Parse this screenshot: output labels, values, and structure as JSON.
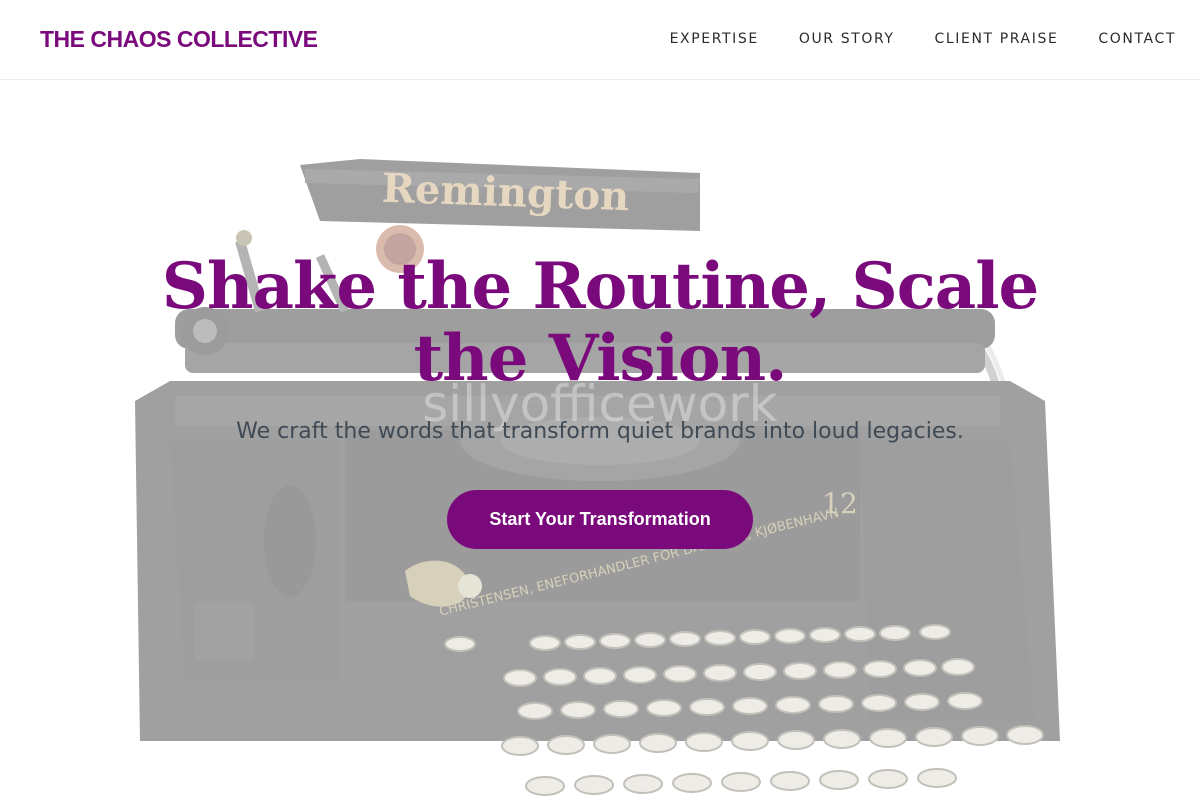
{
  "header": {
    "brand": "THE CHAOS COLLECTIVE",
    "nav": [
      {
        "label": "EXPERTISE"
      },
      {
        "label": "OUR STORY"
      },
      {
        "label": "CLIENT PRAISE"
      },
      {
        "label": "CONTACT"
      }
    ]
  },
  "hero": {
    "headline": "Shake the Routine, Scale the Vision.",
    "subhead": "We craft the words that transform quiet brands into loud legacies.",
    "cta_label": "Start Your Transformation",
    "image": {
      "brand_text": "Remington",
      "watermark": "sillyofficework",
      "model_number": "12",
      "plate_text": "CHRISTENSEN, ENEFORHANDLER FOR DANMARK, KJØBENHAVN"
    }
  },
  "colors": {
    "accent": "#7a0a7c",
    "nav_text": "#2b2b2b",
    "subhead_text": "#3f4a55"
  }
}
